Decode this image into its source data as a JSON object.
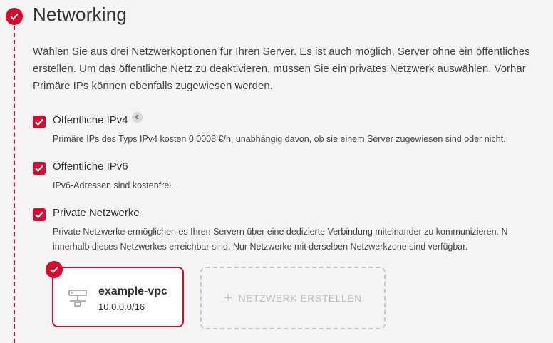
{
  "section": {
    "title": "Networking",
    "intro_lines": [
      "Wählen Sie aus drei Netzwerkoptionen für Ihren Server. Es ist auch möglich, Server ohne ein öffentliches",
      "erstellen. Um das öffentliche Netz zu deaktivieren, müssen Sie ein privates Netzwerk auswählen. Vorhar",
      "Primäre IPs können ebenfalls zugewiesen werden."
    ]
  },
  "options": [
    {
      "label": "Öffentliche IPv4",
      "checked": true,
      "badge": "€",
      "description_lines": [
        "Primäre IPs des Typs IPv4 kosten 0,0008 €/h, unabhängig davon, ob sie einem Server zugewiesen sind oder nicht."
      ]
    },
    {
      "label": "Öffentliche IPv6",
      "checked": true,
      "description_lines": [
        "IPv6-Adressen sind kostenfrei."
      ]
    },
    {
      "label": "Private Netzwerke",
      "checked": true,
      "description_lines": [
        "Private Netzwerke ermöglichen es Ihren Servern über eine dedizierte Verbindung miteinander zu kommunizieren. N",
        "innerhalb dieses Netzwerkes erreichbar sind. Nur Netzwerke mit derselben Netzwerkzone sind verfügbar."
      ]
    }
  ],
  "networks": [
    {
      "name": "example-vpc",
      "range": "10.0.0.0/16",
      "selected": true,
      "icon": "network-icon"
    }
  ],
  "create_network": {
    "label": "NETZWERK ERSTELLEN",
    "icon": "plus-icon"
  },
  "colors": {
    "accent": "#d50c2d",
    "background": "#f4f4f4",
    "muted": "#bdbdbd"
  }
}
